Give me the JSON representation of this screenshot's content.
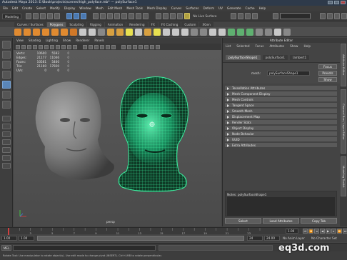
{
  "window": {
    "title": "Autodesk Maya 2013: E:\\Book\\projects\\scenes\\high_polyface.mb*   ---   polySurface1"
  },
  "menubar": {
    "items": [
      "File",
      "Edit",
      "Create",
      "Select",
      "Modify",
      "Display",
      "Window",
      "Mesh",
      "Edit Mesh",
      "Mesh Tools",
      "Mesh Display",
      "Curves",
      "Surfaces",
      "Deform",
      "UV",
      "Generate",
      "Cache",
      "Help"
    ]
  },
  "statusline": {
    "mode": "Modeling",
    "no_live": "No Live Surface"
  },
  "shelf": {
    "tabs": [
      "Curves / Surfaces",
      "Polygons",
      "Sculpting",
      "Rigging",
      "Animation",
      "Rendering",
      "FX",
      "FX Caching",
      "Custom",
      "XGen"
    ],
    "active_tab": "Polygons"
  },
  "viewport": {
    "menu": [
      "View",
      "Shading",
      "Lighting",
      "Show",
      "Renderer",
      "Panels"
    ],
    "hud": {
      "rows": [
        {
          "label": "Verts:",
          "v1": "10600",
          "v2": "5592",
          "v3": "0"
        },
        {
          "label": "Edges:",
          "v1": "21177",
          "v2": "11046",
          "v3": "0"
        },
        {
          "label": "Faces:",
          "v1": "10581",
          "v2": "5460",
          "v3": "0"
        },
        {
          "label": "Tris:",
          "v1": "21160",
          "v2": "17920",
          "v3": "0"
        },
        {
          "label": "UVs:",
          "v1": "0",
          "v2": "0",
          "v3": "0"
        }
      ]
    },
    "camera_label": "persp"
  },
  "attribute_editor": {
    "title": "Attribute Editor",
    "menu": [
      "List",
      "Selected",
      "Focus",
      "Attributes",
      "Show",
      "Help"
    ],
    "tabs": [
      "polySurfaceShape1",
      "polySurface1",
      "lambert1"
    ],
    "active_tab": "polySurfaceShape1",
    "mesh_label": "mesh:",
    "mesh_value": "polySurfaceShape1",
    "focus_btn": "Focus",
    "presets_btn": "Presets",
    "show_btn": "Show",
    "sections": [
      "Tessellation Attributes",
      "Mesh Component Display",
      "Mesh Controls",
      "Tangent Space",
      "Smooth Mesh",
      "Displacement Map",
      "Render Stats",
      "Object Display",
      "Node Behavior",
      "UUID",
      "Extra Attributes"
    ],
    "notes_label": "Notes:  polySurfaceShape1",
    "buttons": [
      "Select",
      "Load Attributes",
      "Copy Tab"
    ]
  },
  "side_tabs": [
    "Attribute Editor",
    "Channel Box / Layer Editor",
    "Modeling Toolkit"
  ],
  "timeslider": {
    "ticks": [
      "1",
      "2",
      "3",
      "4",
      "5",
      "6",
      "7",
      "8",
      "9",
      "10",
      "11",
      "12",
      "13",
      "14",
      "15",
      "16",
      "17",
      "18",
      "19",
      "20",
      "21",
      "22",
      "23",
      "24"
    ],
    "current_frame": "1.00"
  },
  "rangeslider": {
    "start": "1.00",
    "inner_start": "1.00",
    "inner_end": "24",
    "end": "24.00",
    "anim_layer": "No Anim Layer",
    "char_set": "No Character Set"
  },
  "cmdline": {
    "tag": "MEL"
  },
  "helpline": {
    "text": "Rotate Tool: Use manipulator to rotate object(s). Use edit mode to change pivot (INSERT). Ctrl+LMB to rotate perpendicular."
  },
  "watermark": "eq3d.com",
  "colors": {
    "wireframe": "#3cf0a0",
    "active_tab": "#5b5b5b",
    "titlebar": "#2e3a4a"
  }
}
